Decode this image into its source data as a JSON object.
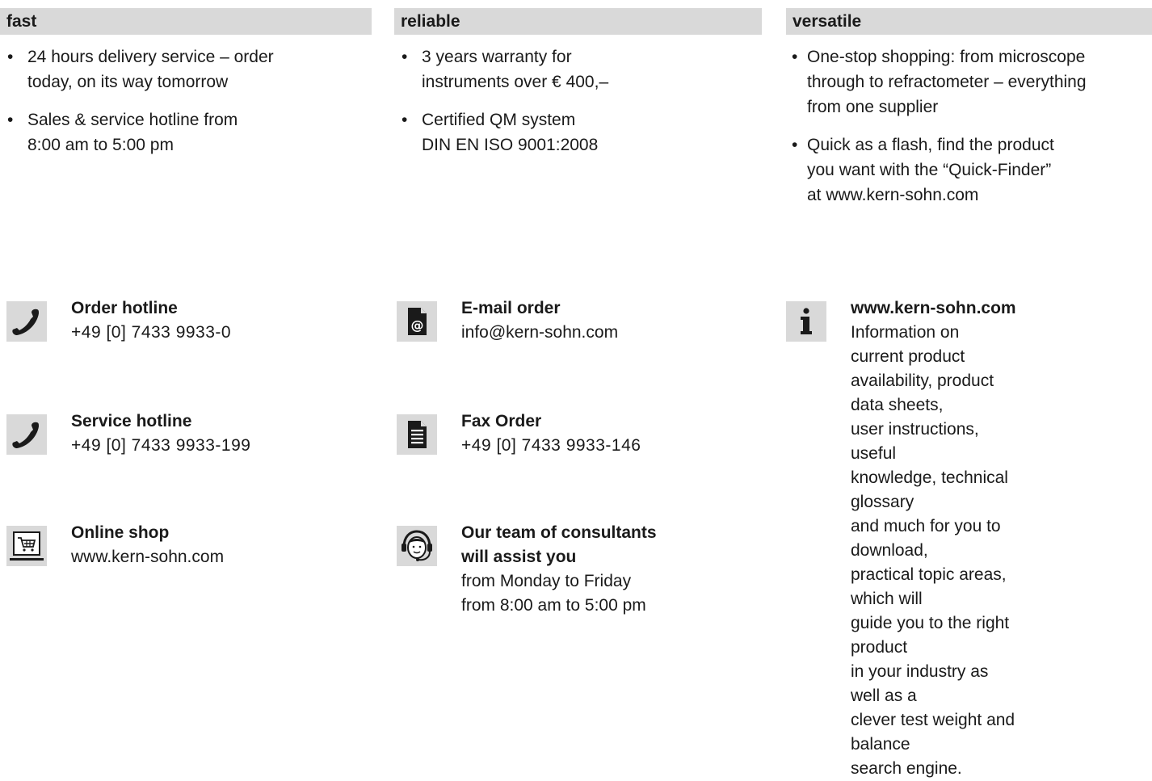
{
  "columns": [
    {
      "header": "fast",
      "bullets": [
        [
          "24 hours delivery service – order",
          "today, on its way tomorrow"
        ],
        [
          "Sales & service hotline from",
          "8:00 am to 5:00 pm"
        ]
      ]
    },
    {
      "header": "reliable",
      "bullets": [
        [
          "3 years warranty for",
          "instruments over € 400,–"
        ],
        [
          "Certified QM system",
          "DIN EN ISO 9001:2008"
        ]
      ]
    },
    {
      "header": "versatile",
      "bullets": [
        [
          "One-stop shopping: from microscope",
          "through to refractometer – everything",
          "from one supplier"
        ],
        [
          "Quick as a flash, find the product",
          "you want with the “Quick-Finder”",
          "at www.kern-sohn.com"
        ]
      ]
    }
  ],
  "bullet_glyph": "•",
  "contacts": {
    "order_hotline": {
      "title": "Order hotline",
      "value": "+49 [0] 7433 9933-0",
      "icon": "phone-icon"
    },
    "service_hotline": {
      "title": "Service hotline",
      "value": "+49 [0] 7433 9933-199",
      "icon": "phone-icon"
    },
    "online_shop": {
      "title": "Online shop",
      "value": "www.kern-sohn.com",
      "icon": "shopping-cart-icon"
    },
    "email_order": {
      "title": "E-mail order",
      "value": "info@kern-sohn.com",
      "icon": "email-icon"
    },
    "fax_order": {
      "title": "Fax Order",
      "value": "+49 [0] 7433 9933-146",
      "icon": "fax-document-icon"
    },
    "consultants": {
      "title_lines": [
        "Our team of consultants",
        "will assist you"
      ],
      "value_lines": [
        "from Monday to Friday",
        "from 8:00 am to 5:00 pm"
      ],
      "icon": "headset-icon"
    },
    "website": {
      "title": "www.kern-sohn.com",
      "description_lines": [
        "Information on current product",
        "availability, product data sheets,",
        "user instructions, useful",
        "knowledge, technical glossary",
        "and much for you to download,",
        "practical topic areas, which will",
        "guide you to the right product",
        "in your industry as well as a",
        "clever test weight and balance",
        "search engine."
      ],
      "icon": "info-icon"
    }
  },
  "colors": {
    "header_bg": "#d9d9d9",
    "icon_bg": "#d9d9d9",
    "icon_fg": "#1a1a1a"
  }
}
